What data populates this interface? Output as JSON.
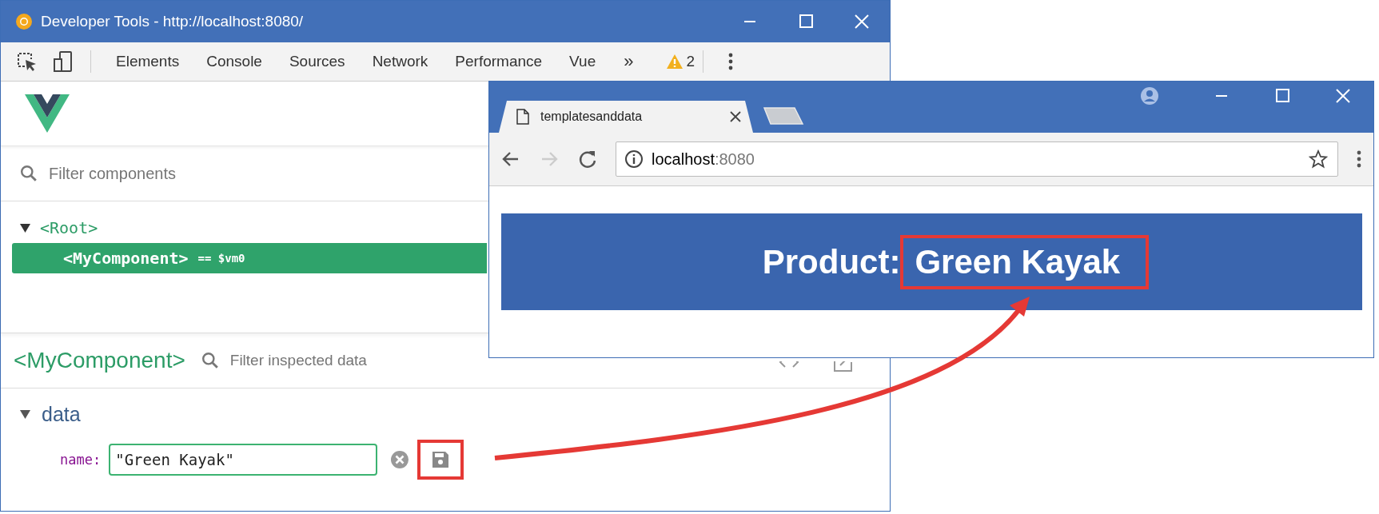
{
  "devtools": {
    "title": "Developer Tools - http://localhost:8080/",
    "tabs": [
      {
        "label": "Elements"
      },
      {
        "label": "Console"
      },
      {
        "label": "Sources"
      },
      {
        "label": "Network"
      },
      {
        "label": "Performance"
      },
      {
        "label": "Vue"
      }
    ],
    "overflow": "»",
    "warnings": "2",
    "filter": {
      "placeholder": "Filter components"
    },
    "tree": [
      {
        "label": "<Root>",
        "expanded": true,
        "selected": false,
        "children": [
          {
            "label": "<MyComponent>",
            "suffix": "== $vm0",
            "selected": true
          }
        ]
      }
    ],
    "inspector": {
      "component": "<MyComponent>",
      "filter": {
        "placeholder": "Filter inspected data"
      },
      "sections": [
        {
          "label": "data",
          "expanded": true,
          "fields": [
            {
              "key": "name:",
              "value": "\"Green Kayak\""
            }
          ]
        }
      ]
    }
  },
  "browser": {
    "tab": {
      "title": "templatesanddata"
    },
    "address": {
      "host": "localhost",
      "port": ":8080"
    },
    "banner": {
      "label": "Product:",
      "value": "Green Kayak"
    }
  }
}
